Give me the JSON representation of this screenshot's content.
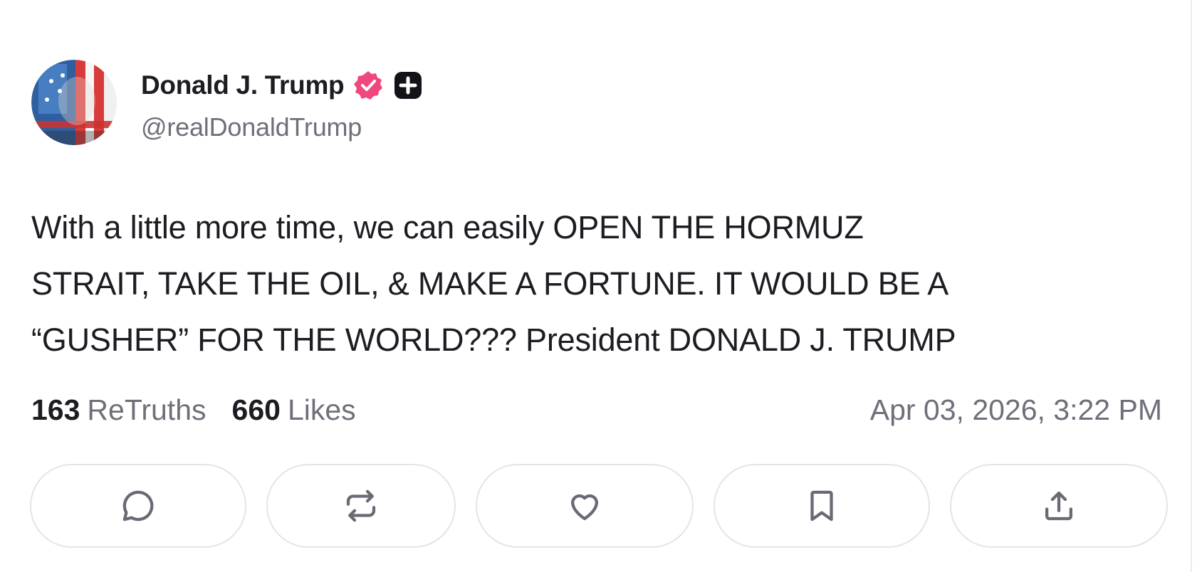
{
  "author": {
    "display_name": "Donald J. Trump",
    "handle": "@realDonaldTrump",
    "avatar_icon": "avatar-image",
    "verified_icon": "verified-badge-icon",
    "plus_icon": "plus-badge-icon",
    "verified_color": "#f0487d"
  },
  "post": {
    "text": "With a little more time, we can easily OPEN THE HORMUZ\nSTRAIT, TAKE THE OIL, & MAKE A FORTUNE. IT WOULD BE A\n“GUSHER” FOR THE WORLD??? President DONALD J. TRUMP"
  },
  "stats": {
    "retruths_count": "163",
    "retruths_label": "ReTruths",
    "likes_count": "660",
    "likes_label": "Likes",
    "timestamp": "Apr 03, 2026, 3:22 PM"
  },
  "actions": [
    {
      "name": "reply",
      "icon": "comment-icon"
    },
    {
      "name": "retruth",
      "icon": "repost-icon"
    },
    {
      "name": "like",
      "icon": "heart-icon"
    },
    {
      "name": "save",
      "icon": "bookmark-icon"
    },
    {
      "name": "share",
      "icon": "share-upload-icon"
    }
  ],
  "colors": {
    "text_primary": "#1c1c22",
    "text_secondary": "#6f6f7a",
    "button_border": "#e4e4ea"
  }
}
